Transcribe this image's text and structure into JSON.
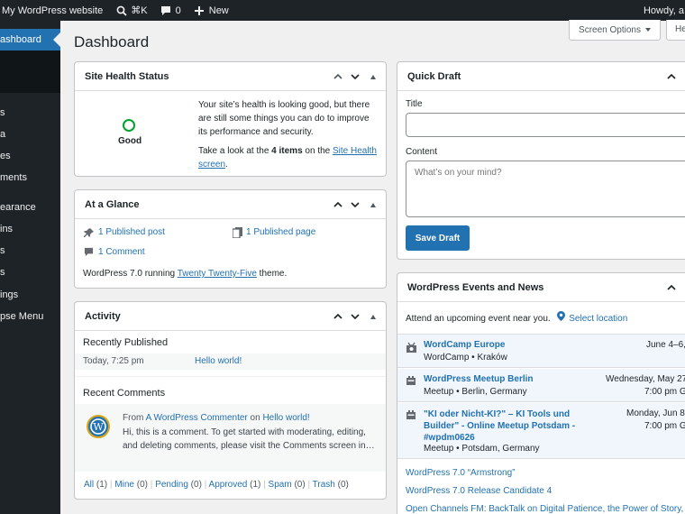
{
  "adminbar": {
    "site_name": "My WordPress website",
    "shortcut": "⌘K",
    "comments_count": "0",
    "new_label": "New",
    "howdy": "Howdy, a"
  },
  "sidebar": {
    "active": "ashboard",
    "items": [
      "s",
      "a",
      "es",
      "ments",
      "earance",
      "ins",
      "s",
      "s",
      "ings",
      "pse Menu"
    ]
  },
  "page": {
    "title": "Dashboard",
    "screen_options": "Screen Options",
    "help": "He"
  },
  "site_health": {
    "title": "Site Health Status",
    "status": "Good",
    "text": "Your site’s health is looking good, but there are still some things you can do to improve its performance and security.",
    "look_prefix": "Take a look at the",
    "items_count": "4 items",
    "look_mid": "on the",
    "link": "Site Health screen",
    "period": "."
  },
  "glance": {
    "title": "At a Glance",
    "posts": "1 Published post",
    "pages": "1 Published page",
    "comments": "1 Comment",
    "running_prefix": "WordPress 7.0 running",
    "theme": "Twenty Twenty-Five",
    "running_suffix": "theme."
  },
  "activity": {
    "title": "Activity",
    "recently_published": "Recently Published",
    "pub_date": "Today, 7:25 pm",
    "pub_title": "Hello world!",
    "recent_comments": "Recent Comments",
    "from_label": "From",
    "commenter": "A WordPress Commenter",
    "on_label": "on",
    "comment_post": "Hello world!",
    "comment_text": "Hi, this is a comment. To get started with moderating, editing, and deleting comments, please visit the Comments screen in…",
    "filters": [
      {
        "label": "All",
        "count": "(1)"
      },
      {
        "label": "Mine",
        "count": "(0)"
      },
      {
        "label": "Pending",
        "count": "(0)"
      },
      {
        "label": "Approved",
        "count": "(1)"
      },
      {
        "label": "Spam",
        "count": "(0)"
      },
      {
        "label": "Trash",
        "count": "(0)"
      }
    ]
  },
  "quick_draft": {
    "title": "Quick Draft",
    "title_label": "Title",
    "content_label": "Content",
    "content_placeholder": "What’s on your mind?",
    "save": "Save Draft"
  },
  "events": {
    "title": "WordPress Events and News",
    "attend": "Attend an upcoming event near you.",
    "select_location": "Select location",
    "list": [
      {
        "name": "WordCamp Europe",
        "meta": "WordCamp • Kraków",
        "date": "June 4–6,",
        "time": ""
      },
      {
        "name": "WordPress Meetup Berlin",
        "meta": "Meetup • Berlin, Germany",
        "date": "Wednesday, May 27,",
        "time": "7:00 pm G"
      },
      {
        "name": "\"KI oder Nicht-KI?\" – KI Tools und Builder\" - Online Meetup Potsdam - #wpdm0626",
        "meta": "Meetup • Potsdam, Germany",
        "date": "Monday, Jun 8,",
        "time": "7:00 pm G"
      }
    ],
    "news": [
      "WordPress 7.0 “Armstrong”",
      "WordPress 7.0 Release Candidate 4",
      "Open Channels FM: BackTalk on Digital Patience, the Power of Story, Pla"
    ]
  },
  "colors": {
    "admin_bar": "#1d2327",
    "accent": "#2271b1",
    "good": "#00a32a",
    "event_bg": "#f0f6fc"
  }
}
